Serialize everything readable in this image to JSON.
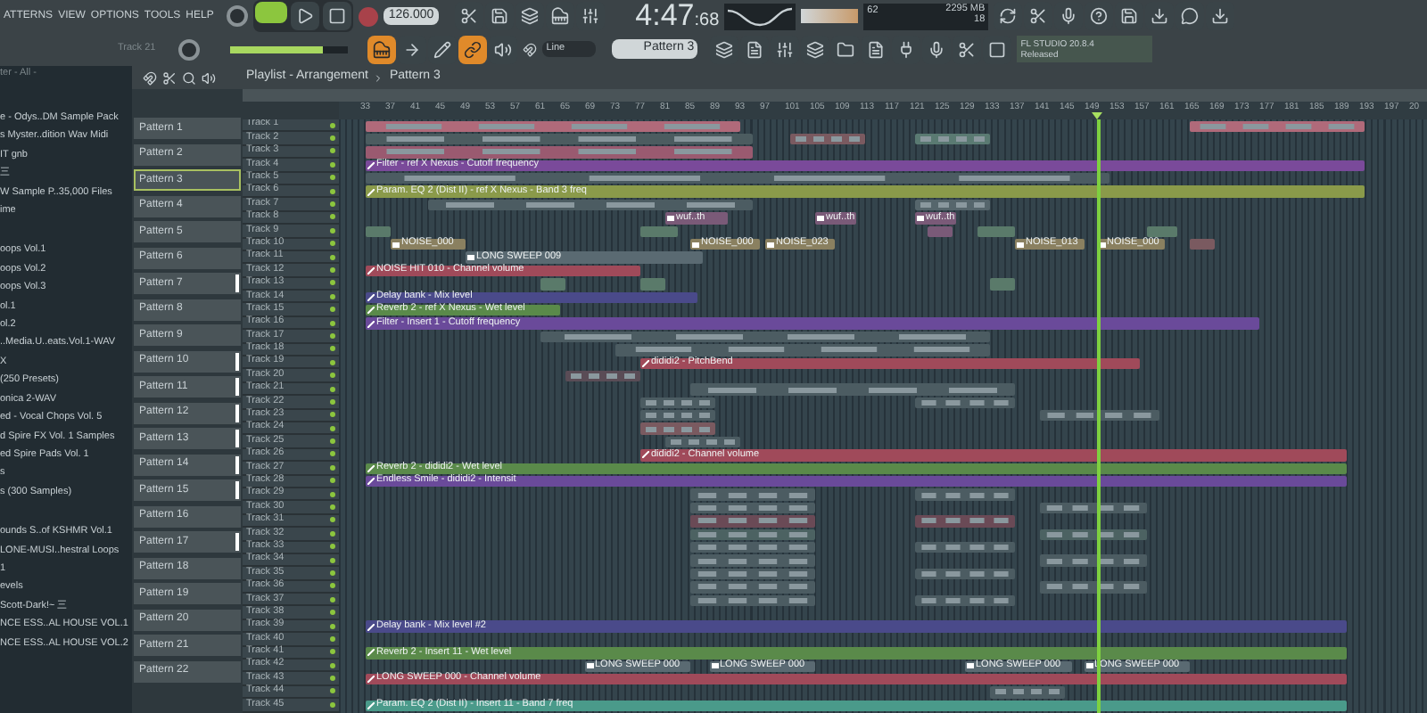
{
  "menu": [
    "ATTERNS",
    "VIEW",
    "OPTIONS",
    "TOOLS",
    "HELP"
  ],
  "hint": "Track 21",
  "master_volume": {
    "level": 0.78
  },
  "tempo": "126.000",
  "time": {
    "main": "4:47",
    "cs": ":68"
  },
  "cpu": {
    "value": "62",
    "memory": "2295 MB",
    "polyphony": "18"
  },
  "snap": "Line",
  "pattern_selector": "Pattern 3",
  "news": {
    "title": "FL STUDIO 20.8.4",
    "status": "Released"
  },
  "browser": {
    "header": "ter - All -",
    "items": [
      {
        "label": "e - Odys..DM Sample Pack",
        "gap_before": false
      },
      {
        "label": "s Myster..dition Wav Midi",
        "gap_before": false
      },
      {
        "label": "IT gnb",
        "gap_before": false
      },
      {
        "label": "三",
        "gap_before": false
      },
      {
        "label": "W Sample P..35,000 Files",
        "gap_before": false
      },
      {
        "label": "ime",
        "gap_before": false
      },
      {
        "label": "oops Vol.1",
        "gap_before": true
      },
      {
        "label": "oops Vol.2",
        "gap_before": false
      },
      {
        "label": "oops Vol.3",
        "gap_before": false
      },
      {
        "label": "ol.1",
        "gap_before": false
      },
      {
        "label": "ol.2",
        "gap_before": false
      },
      {
        "label": "..Media.U..eats.Vol.1-WAV",
        "gap_before": false
      },
      {
        "label": "X",
        "gap_before": false
      },
      {
        "label": "(250 Presets)",
        "gap_before": false
      },
      {
        "label": "onica 2-WAV",
        "gap_before": false
      },
      {
        "label": "ed - Vocal Chops Vol. 5",
        "gap_before": false
      },
      {
        "label": "d Spire FX Vol. 1 Samples",
        "gap_before": false
      },
      {
        "label": "ed Spire Pads Vol. 1",
        "gap_before": false
      },
      {
        "label": "s",
        "gap_before": false
      },
      {
        "label": "s (300 Samples)",
        "gap_before": false
      },
      {
        "label": "ounds S..of KSHMR Vol.1",
        "gap_before": true
      },
      {
        "label": "LONE-MUSI..hestral Loops",
        "gap_before": false
      },
      {
        "label": "1",
        "gap_before": false
      },
      {
        "label": "evels",
        "gap_before": false
      },
      {
        "label": "Scott-Dark!~ 三",
        "gap_before": false
      },
      {
        "label": "NCE ESS..AL HOUSE VOL.1",
        "gap_before": false
      },
      {
        "label": "NCE ESS..AL HOUSE VOL.2",
        "gap_before": false
      }
    ]
  },
  "patterns": [
    {
      "label": "Pattern 1",
      "selected": false,
      "flagged": false
    },
    {
      "label": "Pattern 2",
      "selected": false,
      "flagged": false
    },
    {
      "label": "Pattern 3",
      "selected": true,
      "flagged": false
    },
    {
      "label": "Pattern 4",
      "selected": false,
      "flagged": false
    },
    {
      "label": "Pattern 5",
      "selected": false,
      "flagged": false
    },
    {
      "label": "Pattern 6",
      "selected": false,
      "flagged": false
    },
    {
      "label": "Pattern 7",
      "selected": false,
      "flagged": true
    },
    {
      "label": "Pattern 8",
      "selected": false,
      "flagged": false
    },
    {
      "label": "Pattern 9",
      "selected": false,
      "flagged": false
    },
    {
      "label": "Pattern 10",
      "selected": false,
      "flagged": true
    },
    {
      "label": "Pattern 11",
      "selected": false,
      "flagged": true
    },
    {
      "label": "Pattern 12",
      "selected": false,
      "flagged": true
    },
    {
      "label": "Pattern 13",
      "selected": false,
      "flagged": true
    },
    {
      "label": "Pattern 14",
      "selected": false,
      "flagged": true
    },
    {
      "label": "Pattern 15",
      "selected": false,
      "flagged": true
    },
    {
      "label": "Pattern 16",
      "selected": false,
      "flagged": false
    },
    {
      "label": "Pattern 17",
      "selected": false,
      "flagged": true
    },
    {
      "label": "Pattern 18",
      "selected": false,
      "flagged": false
    },
    {
      "label": "Pattern 19",
      "selected": false,
      "flagged": false
    },
    {
      "label": "Pattern 20",
      "selected": false,
      "flagged": false
    },
    {
      "label": "Pattern 21",
      "selected": false,
      "flagged": false
    },
    {
      "label": "Pattern 22",
      "selected": false,
      "flagged": false
    }
  ],
  "playlist": {
    "title": "Playlist - Arrangement",
    "crumb": "Pattern 3",
    "ruler": [
      "33",
      "37",
      "41",
      "45",
      "49",
      "53",
      "57",
      "61",
      "65",
      "69",
      "73",
      "77",
      "81",
      "85",
      "89",
      "93",
      "97",
      "101",
      "105",
      "109",
      "113",
      "117",
      "121",
      "125",
      "129",
      "133",
      "137",
      "141",
      "145",
      "149",
      "153",
      "157",
      "161",
      "165",
      "169",
      "173",
      "177",
      "181",
      "185",
      "189",
      "193",
      "197",
      "20"
    ],
    "tracks": [
      {
        "name": "Track 1",
        "clips": [
          {
            "kind": "pattern",
            "color": "#b06a7a"
          },
          {
            "kind": "pattern",
            "color": "#b06a7a"
          }
        ]
      },
      {
        "name": "Track 2",
        "clips": [
          {
            "kind": "pattern",
            "color": "#4c5c60"
          },
          {
            "kind": "pattern",
            "color": "#7a5a60"
          },
          {
            "kind": "pattern",
            "color": "#5a7a72"
          }
        ]
      },
      {
        "name": "Track 3",
        "clips": [
          {
            "kind": "pattern",
            "color": "#9a5a70"
          }
        ]
      },
      {
        "name": "Track 4",
        "clips": [
          {
            "kind": "automation",
            "color": "#7a4a9a",
            "label": "Filter - ref X Nexus - Cutoff frequency"
          }
        ]
      },
      {
        "name": "Track 5",
        "clips": [
          {
            "kind": "pattern",
            "color": "#4c5c62"
          }
        ]
      },
      {
        "name": "Track 6",
        "clips": [
          {
            "kind": "automation",
            "color": "#8a9a4a",
            "label": "Param. EQ 2 (Dist II) - ref X Nexus - Band 3 freq"
          }
        ]
      },
      {
        "name": "Track 7",
        "clips": [
          {
            "kind": "pattern",
            "color": "#4c5c62"
          },
          {
            "kind": "pattern",
            "color": "#56666c"
          }
        ]
      },
      {
        "name": "Track 8",
        "clips": [
          {
            "kind": "audio",
            "color": "#7a5a78",
            "label": "wuf..th"
          },
          {
            "kind": "audio",
            "color": "#7a5a78",
            "label": "wuf..th"
          },
          {
            "kind": "audio",
            "color": "#7a5a78",
            "label": "wuf..th"
          }
        ]
      },
      {
        "name": "Track 9",
        "clips": [
          {
            "kind": "audio",
            "color": "#5a7a6a"
          },
          {
            "kind": "audio",
            "color": "#5a7a6a"
          },
          {
            "kind": "audio",
            "color": "#7a5a78"
          },
          {
            "kind": "audio",
            "color": "#5a7a6a"
          },
          {
            "kind": "audio",
            "color": "#5a7a6a"
          }
        ]
      },
      {
        "name": "Track 10",
        "clips": [
          {
            "kind": "audio",
            "color": "#8a8060",
            "label": "NOISE_000"
          },
          {
            "kind": "audio",
            "color": "#8a8060",
            "label": "NOISE_000"
          },
          {
            "kind": "audio",
            "color": "#8a8060",
            "label": "NOISE_023"
          },
          {
            "kind": "audio",
            "color": "#8a8060",
            "label": "NOISE_013"
          },
          {
            "kind": "audio",
            "color": "#8a8060",
            "label": "NOISE_000"
          },
          {
            "kind": "audio",
            "color": "#7a5a60"
          }
        ]
      },
      {
        "name": "Track 11",
        "clips": [
          {
            "kind": "audio",
            "color": "#5a6a72",
            "label": "LONG SWEEP 009"
          }
        ]
      },
      {
        "name": "Track 12",
        "clips": [
          {
            "kind": "automation",
            "color": "#a04a5a",
            "label": "NOISE HIT 010 - Channel volume"
          }
        ]
      },
      {
        "name": "Track 13",
        "clips": [
          {
            "kind": "audio",
            "color": "#5a7a6a"
          },
          {
            "kind": "audio",
            "color": "#5a7a6a"
          },
          {
            "kind": "audio",
            "color": "#5a7a6a"
          }
        ]
      },
      {
        "name": "Track 14",
        "clips": [
          {
            "kind": "automation",
            "color": "#4a4a8a",
            "label": "Delay bank - Mix level"
          }
        ]
      },
      {
        "name": "Track 15",
        "clips": [
          {
            "kind": "automation",
            "color": "#5a8a4a",
            "label": "Reverb 2 - ref X Nexus - Wet level"
          }
        ]
      },
      {
        "name": "Track 16",
        "clips": [
          {
            "kind": "automation",
            "color": "#6a4a9a",
            "label": "Filter - Insert 1 - Cutoff frequency"
          }
        ]
      },
      {
        "name": "Track 17",
        "clips": [
          {
            "kind": "pattern",
            "color": "#4c5c62"
          }
        ]
      },
      {
        "name": "Track 18",
        "clips": [
          {
            "kind": "pattern",
            "color": "#4c5c62"
          }
        ]
      },
      {
        "name": "Track 19",
        "clips": [
          {
            "kind": "automation",
            "color": "#a04a5a",
            "label": "dididi2 - PitchBend"
          }
        ]
      },
      {
        "name": "Track 20",
        "clips": [
          {
            "kind": "pattern",
            "color": "#5a4c56"
          }
        ]
      },
      {
        "name": "Track 21",
        "clips": [
          {
            "kind": "pattern",
            "color": "#4c5c62"
          }
        ]
      },
      {
        "name": "Track 22",
        "clips": [
          {
            "kind": "pattern",
            "color": "#4c5c62"
          },
          {
            "kind": "pattern",
            "color": "#4c5c62"
          }
        ]
      },
      {
        "name": "Track 23",
        "clips": [
          {
            "kind": "pattern",
            "color": "#4c5c62"
          },
          {
            "kind": "pattern",
            "color": "#4c5c62"
          }
        ]
      },
      {
        "name": "Track 24",
        "clips": [
          {
            "kind": "pattern",
            "color": "#7a5a60"
          }
        ]
      },
      {
        "name": "Track 25",
        "clips": [
          {
            "kind": "pattern",
            "color": "#4c5c62"
          }
        ]
      },
      {
        "name": "Track 26",
        "clips": [
          {
            "kind": "automation",
            "color": "#a04a5a",
            "label": "dididi2 - Channel volume"
          }
        ]
      },
      {
        "name": "Track 27",
        "clips": [
          {
            "kind": "automation",
            "color": "#5a8a4a",
            "label": "Reverb 2 - dididi2 - Wet level"
          }
        ]
      },
      {
        "name": "Track 28",
        "clips": [
          {
            "kind": "automation",
            "color": "#6a4a9a",
            "label": "Endless Smile - dididi2 - Intensit"
          }
        ]
      },
      {
        "name": "Track 29",
        "clips": [
          {
            "kind": "pattern",
            "color": "#4c5c62"
          },
          {
            "kind": "pattern",
            "color": "#4c5c62"
          }
        ]
      },
      {
        "name": "Track 30",
        "clips": [
          {
            "kind": "pattern",
            "color": "#4c5c62"
          },
          {
            "kind": "pattern",
            "color": "#4c5c62"
          }
        ]
      },
      {
        "name": "Track 31",
        "clips": [
          {
            "kind": "pattern",
            "color": "#6a4a56"
          },
          {
            "kind": "pattern",
            "color": "#6a4a56"
          }
        ]
      },
      {
        "name": "Track 32",
        "clips": [
          {
            "kind": "pattern",
            "color": "#4c6262"
          },
          {
            "kind": "pattern",
            "color": "#4c6262"
          }
        ]
      },
      {
        "name": "Track 33",
        "clips": [
          {
            "kind": "pattern",
            "color": "#4c5c62"
          },
          {
            "kind": "pattern",
            "color": "#4c5c62"
          }
        ]
      },
      {
        "name": "Track 34",
        "clips": [
          {
            "kind": "pattern",
            "color": "#4c5c62"
          },
          {
            "kind": "pattern",
            "color": "#4c5c62"
          }
        ]
      },
      {
        "name": "Track 35",
        "clips": [
          {
            "kind": "pattern",
            "color": "#4c5c62"
          },
          {
            "kind": "pattern",
            "color": "#4c5c62"
          }
        ]
      },
      {
        "name": "Track 36",
        "clips": [
          {
            "kind": "pattern",
            "color": "#4c5c62"
          },
          {
            "kind": "pattern",
            "color": "#4c5c62"
          }
        ]
      },
      {
        "name": "Track 37",
        "clips": [
          {
            "kind": "pattern",
            "color": "#4c5c62"
          },
          {
            "kind": "pattern",
            "color": "#4c5c62"
          }
        ]
      },
      {
        "name": "Track 38"
      },
      {
        "name": "Track 39",
        "clips": [
          {
            "kind": "automation",
            "color": "#4a4a8a",
            "label": "Delay bank - Mix level #2"
          }
        ]
      },
      {
        "name": "Track 40"
      },
      {
        "name": "Track 41",
        "clips": [
          {
            "kind": "automation",
            "color": "#5a8a4a",
            "label": "Reverb 2 - Insert 11 - Wet level"
          }
        ]
      },
      {
        "name": "Track 42",
        "clips": [
          {
            "kind": "audio",
            "color": "#5a6a72",
            "label": "LONG SWEEP 000"
          },
          {
            "kind": "audio",
            "color": "#5a6a72",
            "label": "LONG SWEEP 000"
          },
          {
            "kind": "audio",
            "color": "#5a6a72",
            "label": "LONG SWEEP 000"
          },
          {
            "kind": "audio",
            "color": "#5a6a72",
            "label": "LONG SWEEP 000"
          }
        ]
      },
      {
        "name": "Track 43",
        "clips": [
          {
            "kind": "automation",
            "color": "#a04a5a",
            "label": "LONG SWEEP 000 - Channel volume"
          }
        ]
      },
      {
        "name": "Track 44",
        "clips": [
          {
            "kind": "pattern",
            "color": "#4c5c62"
          }
        ]
      },
      {
        "name": "Track 45",
        "clips": [
          {
            "kind": "automation",
            "color": "#4a9a8a",
            "label": "Param. EQ 2 (Dist II) - Insert 11 - Band 7 freq"
          }
        ]
      }
    ]
  }
}
